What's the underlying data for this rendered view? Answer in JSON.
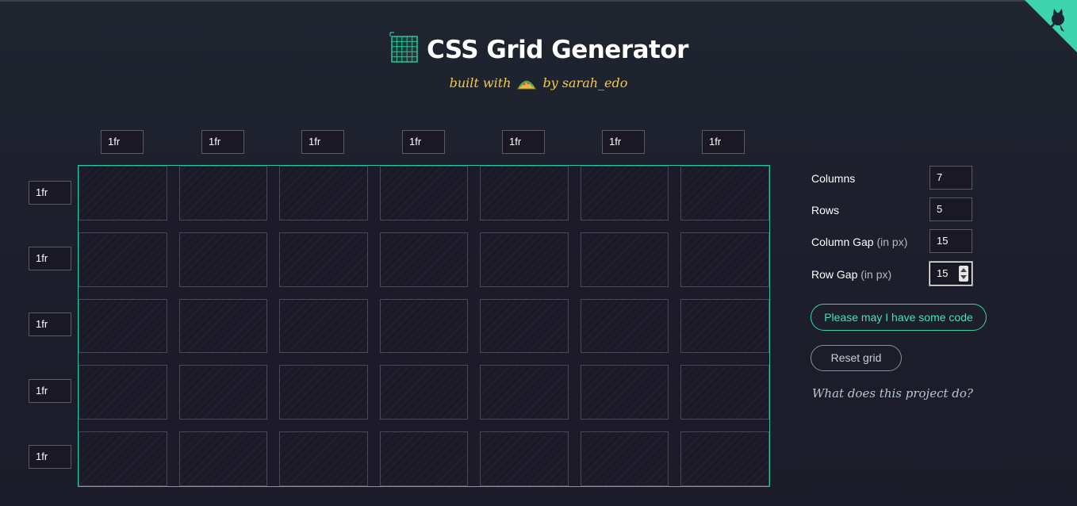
{
  "header": {
    "title": "CSS Grid Generator",
    "built_with": "built with",
    "by": "by sarah_edo"
  },
  "icons": {
    "logo": "grid-logo-icon",
    "taco": "taco-icon",
    "corner": "github-octocat-icon"
  },
  "grid": {
    "columns": [
      "1fr",
      "1fr",
      "1fr",
      "1fr",
      "1fr",
      "1fr",
      "1fr"
    ],
    "rows": [
      "1fr",
      "1fr",
      "1fr",
      "1fr",
      "1fr"
    ]
  },
  "controls": {
    "columns": {
      "label": "Columns",
      "value": "7"
    },
    "rows": {
      "label": "Rows",
      "value": "5"
    },
    "column_gap": {
      "label": "Column Gap",
      "unit": "(in px)",
      "value": "15"
    },
    "row_gap": {
      "label": "Row Gap",
      "unit": "(in px)",
      "value": "15"
    }
  },
  "buttons": {
    "code": "Please may I have some code",
    "reset": "Reset grid"
  },
  "help_link": "What does this project do?",
  "colors": {
    "accent": "#36d6ad",
    "subtitle": "#f2c94c",
    "background": "#1d1f2c"
  }
}
